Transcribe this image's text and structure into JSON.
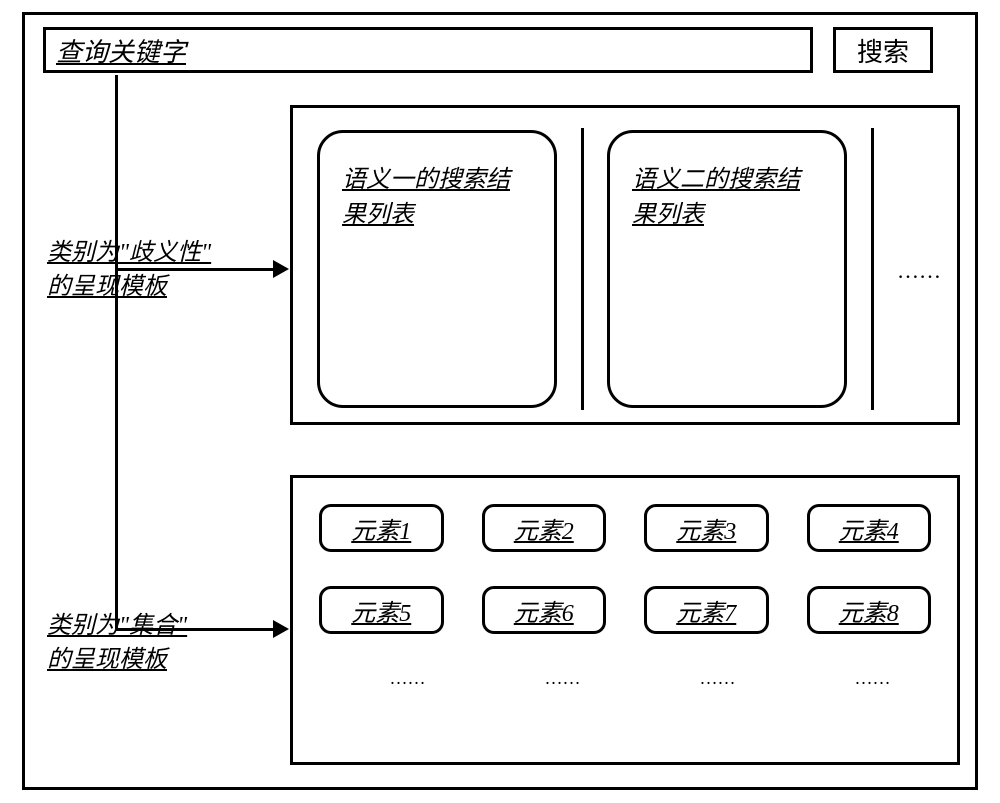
{
  "search": {
    "placeholder": "查询关键字",
    "button_label": "搜索"
  },
  "templates": {
    "ambiguity": {
      "label_line1": "类别为\"歧义性\"",
      "label_line2": "的呈现模板",
      "cards": [
        "语义一的搜索结果列表",
        "语义二的搜索结果列表"
      ],
      "more": "……"
    },
    "collection": {
      "label_line1": "类别为\"集合\"",
      "label_line2": "的呈现模板",
      "elements": [
        "元素1",
        "元素2",
        "元素3",
        "元素4",
        "元素5",
        "元素6",
        "元素7",
        "元素8"
      ],
      "more_row": [
        "……",
        "……",
        "……",
        "……"
      ]
    }
  }
}
